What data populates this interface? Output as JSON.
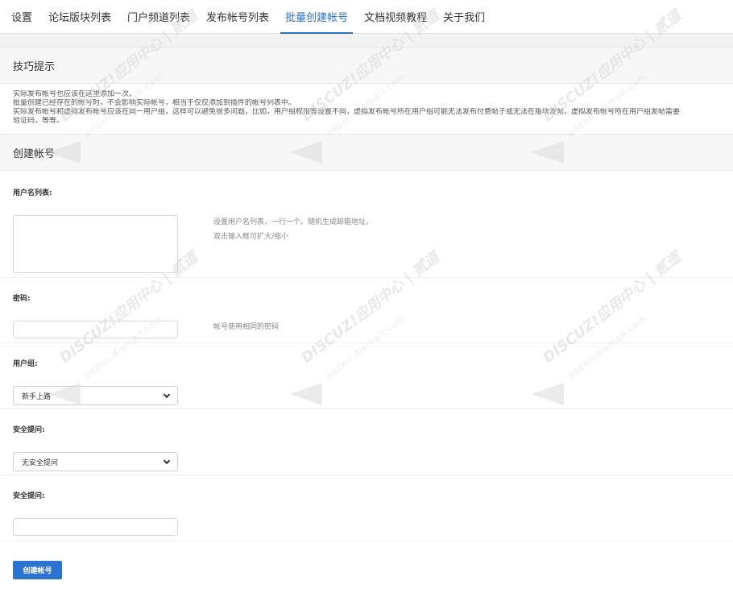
{
  "tabs": [
    {
      "label": "设置"
    },
    {
      "label": "论坛版块列表"
    },
    {
      "label": "门户频道列表"
    },
    {
      "label": "发布帐号列表"
    },
    {
      "label": "批量创建帐号",
      "active": true
    },
    {
      "label": "文档视频教程"
    },
    {
      "label": "关于我们"
    }
  ],
  "tips": {
    "title": "技巧提示",
    "lines": [
      "实际发布帐号也应该在这里添加一次。",
      "批量创建已经存在的帐号时，不会影响实际帐号，相当于仅仅添加到插件的帐号列表中。",
      "实际发布帐号和虚拟发布帐号应该在同一用户组，这样可以避免很多问题，比如，用户组权限等设置不同，虚拟发布帐号所在用户组可能无法发布付费帖子或无法在版块发帖，虚拟发布帐号所在用户组发帖需要",
      "验证码，等等。"
    ]
  },
  "form": {
    "title": "创建帐号",
    "username_list": {
      "label": "用户名列表:",
      "value": "",
      "hint1": "设置用户名列表，一行一个。随机生成邮箱地址。",
      "hint2": "双击输入框可扩大/缩小"
    },
    "password": {
      "label": "密码:",
      "value": "",
      "hint": "帐号使用相同的密码"
    },
    "usergroup": {
      "label": "用户组:",
      "selected": "新手上路"
    },
    "security_question": {
      "label": "安全提问:",
      "selected": "无安全提问"
    },
    "security_answer": {
      "label": "安全提问:",
      "value": ""
    },
    "submit_label": "创建帐号"
  },
  "watermark": {
    "brand": "DISCUZ!应用中心 | 贰道",
    "site": "addon.dismall.com"
  },
  "colors": {
    "accent": "#2a73d0",
    "active_tab": "#2a6fc9",
    "section_bg": "#f7f7f7"
  }
}
